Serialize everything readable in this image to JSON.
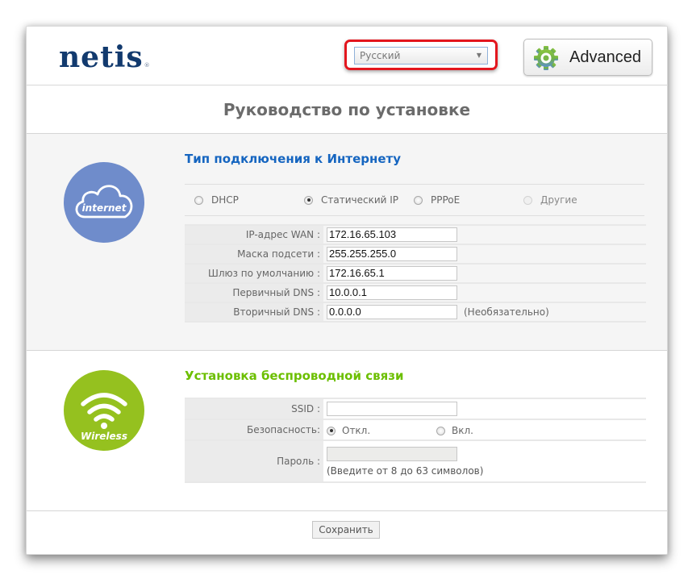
{
  "header": {
    "logo": "netis",
    "logo_mark": "®",
    "language": {
      "selected": "Русский"
    },
    "advanced_button": "Advanced"
  },
  "page_title": "Руководство по установке",
  "internet": {
    "icon_label": "internet",
    "section_title": "Тип подключения к Интернету",
    "connection_types": [
      {
        "label": "DHCP",
        "selected": false,
        "disabled": false
      },
      {
        "label": "Статический IP",
        "selected": true,
        "disabled": false
      },
      {
        "label": "PPPoE",
        "selected": false,
        "disabled": false
      },
      {
        "label": "Другие",
        "selected": false,
        "disabled": true
      }
    ],
    "fields": [
      {
        "label": "IP-адрес WAN :",
        "value": "172.16.65.103"
      },
      {
        "label": "Маска подсети :",
        "value": "255.255.255.0"
      },
      {
        "label": "Шлюз по умолчанию :",
        "value": "172.16.65.1"
      },
      {
        "label": "Первичный DNS :",
        "value": "10.0.0.1"
      },
      {
        "label": "Вторичный DNS :",
        "value": "0.0.0.0",
        "note": "(Необязательно)"
      }
    ]
  },
  "wireless": {
    "icon_label": "Wireless",
    "section_title": "Установка беспроводной связи",
    "ssid": {
      "label": "SSID :",
      "value": ""
    },
    "security": {
      "label": "Безопасность:",
      "options": [
        {
          "label": "Откл.",
          "selected": true
        },
        {
          "label": "Вкл.",
          "selected": false
        }
      ]
    },
    "password": {
      "label": "Пароль :",
      "value": "",
      "hint": "(Введите от 8 до 63 символов)"
    }
  },
  "footer": {
    "save_button": "Сохранить"
  },
  "colors": {
    "brand": "#123a6e",
    "internet_title": "#1565c0",
    "wireless_title": "#6cbf00",
    "internet_circle": "#6f8ccb",
    "wireless_circle": "#95c11f",
    "highlight": "#e3161e"
  }
}
